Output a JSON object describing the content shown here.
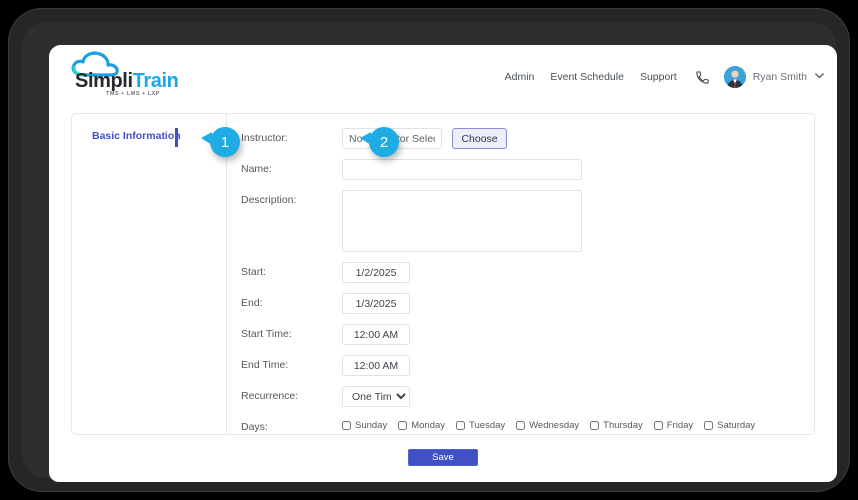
{
  "brand": {
    "name_part1": "Simpli",
    "name_part2": "Train",
    "tagline": "TMS + LMS + LXP",
    "logo_icon": "cloud-icon",
    "accent_color": "#1ea7e8",
    "primary_color": "#3f51c5"
  },
  "header": {
    "nav": [
      {
        "label": "Admin",
        "name": "nav-admin"
      },
      {
        "label": "Event Schedule",
        "name": "nav-event-schedule"
      },
      {
        "label": "Support",
        "name": "nav-support"
      }
    ],
    "phone_icon": "phone-icon",
    "avatar_icon": "user-avatar-icon",
    "user_name": "Ryan Smith",
    "chevron_icon": "chevron-down-icon"
  },
  "form": {
    "section_label": "Basic Information",
    "instructor": {
      "label": "Instructor:",
      "value": "No Instructor Selected",
      "choose_label": "Choose"
    },
    "name": {
      "label": "Name:",
      "value": "",
      "placeholder": ""
    },
    "description": {
      "label": "Description:",
      "value": "",
      "placeholder": ""
    },
    "start": {
      "label": "Start:",
      "value": "1/2/2025"
    },
    "end": {
      "label": "End:",
      "value": "1/3/2025"
    },
    "start_time": {
      "label": "Start Time:",
      "value": "12:00 AM"
    },
    "end_time": {
      "label": "End Time:",
      "value": "12:00 AM"
    },
    "recurrence": {
      "label": "Recurrence:",
      "value": "One Time",
      "options": [
        "One Time"
      ]
    },
    "days": {
      "label": "Days:",
      "items": [
        {
          "label": "Sunday",
          "checked": false
        },
        {
          "label": "Monday",
          "checked": false
        },
        {
          "label": "Tuesday",
          "checked": false
        },
        {
          "label": "Wednesday",
          "checked": false
        },
        {
          "label": "Thursday",
          "checked": false
        },
        {
          "label": "Friday",
          "checked": false
        },
        {
          "label": "Saturday",
          "checked": false
        }
      ]
    }
  },
  "actions": {
    "save_label": "Save"
  },
  "callouts": [
    {
      "number": "1",
      "color": "#1fabe3"
    },
    {
      "number": "2",
      "color": "#1fabe3"
    }
  ]
}
